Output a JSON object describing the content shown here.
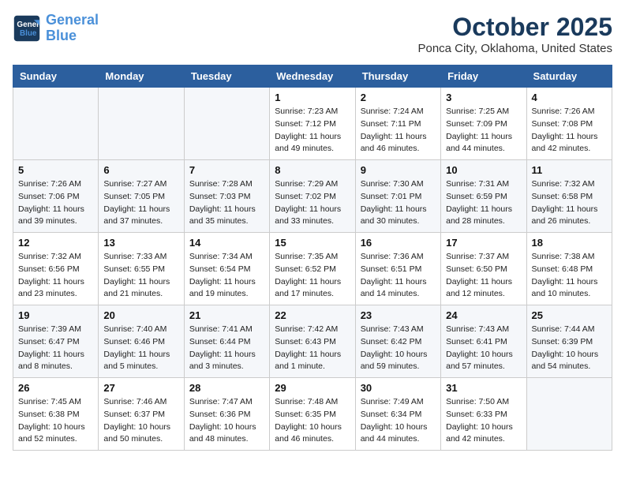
{
  "header": {
    "logo_line1": "General",
    "logo_line2": "Blue",
    "title": "October 2025",
    "subtitle": "Ponca City, Oklahoma, United States"
  },
  "weekdays": [
    "Sunday",
    "Monday",
    "Tuesday",
    "Wednesday",
    "Thursday",
    "Friday",
    "Saturday"
  ],
  "weeks": [
    [
      {
        "day": "",
        "info": ""
      },
      {
        "day": "",
        "info": ""
      },
      {
        "day": "",
        "info": ""
      },
      {
        "day": "1",
        "info": "Sunrise: 7:23 AM\nSunset: 7:12 PM\nDaylight: 11 hours and 49 minutes."
      },
      {
        "day": "2",
        "info": "Sunrise: 7:24 AM\nSunset: 7:11 PM\nDaylight: 11 hours and 46 minutes."
      },
      {
        "day": "3",
        "info": "Sunrise: 7:25 AM\nSunset: 7:09 PM\nDaylight: 11 hours and 44 minutes."
      },
      {
        "day": "4",
        "info": "Sunrise: 7:26 AM\nSunset: 7:08 PM\nDaylight: 11 hours and 42 minutes."
      }
    ],
    [
      {
        "day": "5",
        "info": "Sunrise: 7:26 AM\nSunset: 7:06 PM\nDaylight: 11 hours and 39 minutes."
      },
      {
        "day": "6",
        "info": "Sunrise: 7:27 AM\nSunset: 7:05 PM\nDaylight: 11 hours and 37 minutes."
      },
      {
        "day": "7",
        "info": "Sunrise: 7:28 AM\nSunset: 7:03 PM\nDaylight: 11 hours and 35 minutes."
      },
      {
        "day": "8",
        "info": "Sunrise: 7:29 AM\nSunset: 7:02 PM\nDaylight: 11 hours and 33 minutes."
      },
      {
        "day": "9",
        "info": "Sunrise: 7:30 AM\nSunset: 7:01 PM\nDaylight: 11 hours and 30 minutes."
      },
      {
        "day": "10",
        "info": "Sunrise: 7:31 AM\nSunset: 6:59 PM\nDaylight: 11 hours and 28 minutes."
      },
      {
        "day": "11",
        "info": "Sunrise: 7:32 AM\nSunset: 6:58 PM\nDaylight: 11 hours and 26 minutes."
      }
    ],
    [
      {
        "day": "12",
        "info": "Sunrise: 7:32 AM\nSunset: 6:56 PM\nDaylight: 11 hours and 23 minutes."
      },
      {
        "day": "13",
        "info": "Sunrise: 7:33 AM\nSunset: 6:55 PM\nDaylight: 11 hours and 21 minutes."
      },
      {
        "day": "14",
        "info": "Sunrise: 7:34 AM\nSunset: 6:54 PM\nDaylight: 11 hours and 19 minutes."
      },
      {
        "day": "15",
        "info": "Sunrise: 7:35 AM\nSunset: 6:52 PM\nDaylight: 11 hours and 17 minutes."
      },
      {
        "day": "16",
        "info": "Sunrise: 7:36 AM\nSunset: 6:51 PM\nDaylight: 11 hours and 14 minutes."
      },
      {
        "day": "17",
        "info": "Sunrise: 7:37 AM\nSunset: 6:50 PM\nDaylight: 11 hours and 12 minutes."
      },
      {
        "day": "18",
        "info": "Sunrise: 7:38 AM\nSunset: 6:48 PM\nDaylight: 11 hours and 10 minutes."
      }
    ],
    [
      {
        "day": "19",
        "info": "Sunrise: 7:39 AM\nSunset: 6:47 PM\nDaylight: 11 hours and 8 minutes."
      },
      {
        "day": "20",
        "info": "Sunrise: 7:40 AM\nSunset: 6:46 PM\nDaylight: 11 hours and 5 minutes."
      },
      {
        "day": "21",
        "info": "Sunrise: 7:41 AM\nSunset: 6:44 PM\nDaylight: 11 hours and 3 minutes."
      },
      {
        "day": "22",
        "info": "Sunrise: 7:42 AM\nSunset: 6:43 PM\nDaylight: 11 hours and 1 minute."
      },
      {
        "day": "23",
        "info": "Sunrise: 7:43 AM\nSunset: 6:42 PM\nDaylight: 10 hours and 59 minutes."
      },
      {
        "day": "24",
        "info": "Sunrise: 7:43 AM\nSunset: 6:41 PM\nDaylight: 10 hours and 57 minutes."
      },
      {
        "day": "25",
        "info": "Sunrise: 7:44 AM\nSunset: 6:39 PM\nDaylight: 10 hours and 54 minutes."
      }
    ],
    [
      {
        "day": "26",
        "info": "Sunrise: 7:45 AM\nSunset: 6:38 PM\nDaylight: 10 hours and 52 minutes."
      },
      {
        "day": "27",
        "info": "Sunrise: 7:46 AM\nSunset: 6:37 PM\nDaylight: 10 hours and 50 minutes."
      },
      {
        "day": "28",
        "info": "Sunrise: 7:47 AM\nSunset: 6:36 PM\nDaylight: 10 hours and 48 minutes."
      },
      {
        "day": "29",
        "info": "Sunrise: 7:48 AM\nSunset: 6:35 PM\nDaylight: 10 hours and 46 minutes."
      },
      {
        "day": "30",
        "info": "Sunrise: 7:49 AM\nSunset: 6:34 PM\nDaylight: 10 hours and 44 minutes."
      },
      {
        "day": "31",
        "info": "Sunrise: 7:50 AM\nSunset: 6:33 PM\nDaylight: 10 hours and 42 minutes."
      },
      {
        "day": "",
        "info": ""
      }
    ]
  ]
}
